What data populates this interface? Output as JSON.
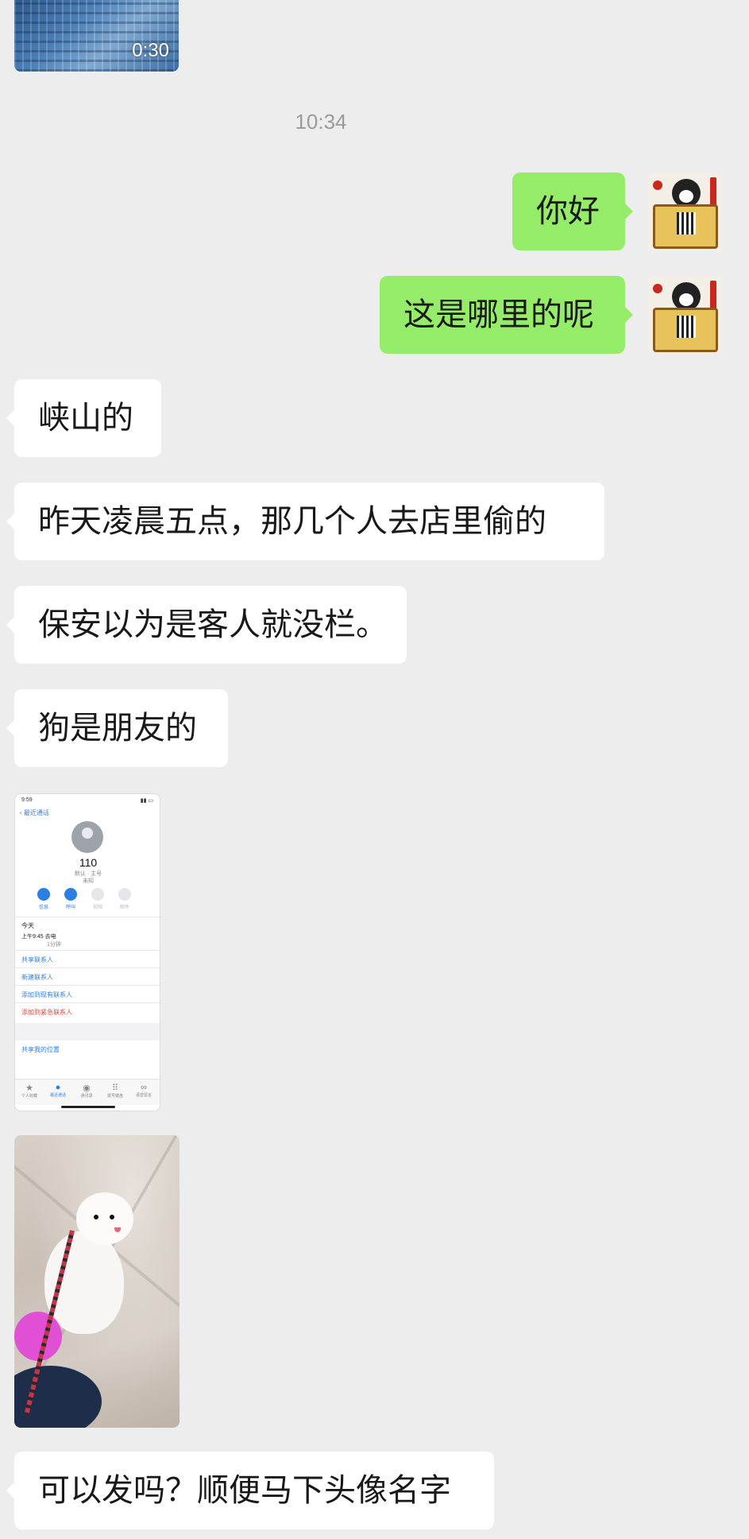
{
  "chat": {
    "video": {
      "duration": "0:30"
    },
    "timestamp": "10:34",
    "messages": [
      {
        "side": "out",
        "text": "你好"
      },
      {
        "side": "out",
        "text": "这是哪里的呢"
      },
      {
        "side": "in",
        "text": "峡山的"
      },
      {
        "side": "in",
        "text": "昨天凌晨五点，那几个人去店里偷的"
      },
      {
        "side": "in",
        "text": "保安以为是客人就没栏。"
      },
      {
        "side": "in",
        "text": "狗是朋友的"
      },
      {
        "side": "in",
        "text": "可以发吗？顺便马下头像名字"
      }
    ]
  },
  "screenshot": {
    "time": "9:59",
    "back_label": "最近通话",
    "number": "110",
    "subtitle": "默认 · 主号",
    "subtitle2": "未知",
    "actions": [
      {
        "label": "信息",
        "enabled": true
      },
      {
        "label": "呼叫",
        "enabled": true
      },
      {
        "label": "视频",
        "enabled": false
      },
      {
        "label": "邮件",
        "enabled": false
      }
    ],
    "section_today": "今天",
    "call_entry": "上午9:45  去电",
    "call_duration": "1分钟",
    "links": [
      {
        "label": "共享联系人",
        "danger": false
      },
      {
        "label": "新建联系人",
        "danger": false
      },
      {
        "label": "添加到现有联系人",
        "danger": false
      },
      {
        "label": "添加到紧急联系人",
        "danger": true
      }
    ],
    "share_location": "共享我的位置",
    "tabs": [
      {
        "icon": "★",
        "label": "个人收藏",
        "active": false
      },
      {
        "icon": "●",
        "label": "最近通话",
        "active": true
      },
      {
        "icon": "◉",
        "label": "通讯录",
        "active": false
      },
      {
        "icon": "⠿",
        "label": "拨号键盘",
        "active": false
      },
      {
        "icon": "∞",
        "label": "语音留言",
        "active": false
      }
    ]
  },
  "colors": {
    "background": "#ededed",
    "bubble_out": "#95ec69",
    "bubble_in": "#ffffff",
    "timestamp": "#9a9a9a"
  }
}
